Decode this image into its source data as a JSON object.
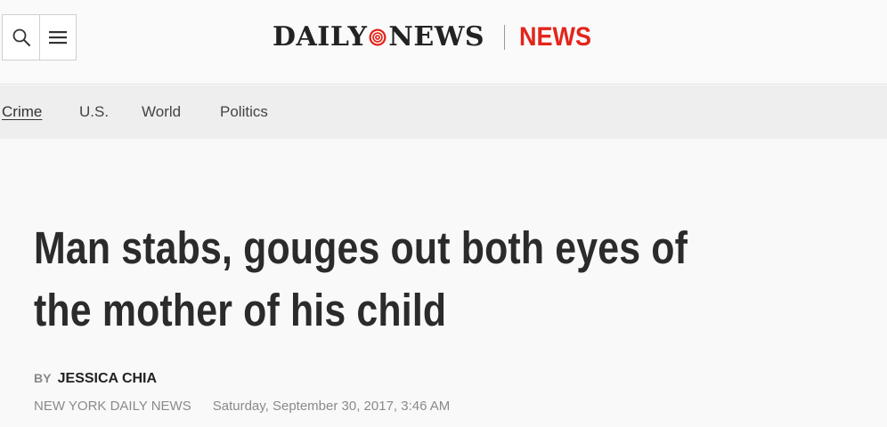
{
  "header": {
    "logo": {
      "word_left": "DAILY",
      "word_right": "NEWS",
      "mark_icon": "daily-news-seal-icon"
    },
    "section": "NEWS",
    "buttons": {
      "search_icon": "search-icon",
      "menu_icon": "hamburger-menu-icon"
    }
  },
  "nav": {
    "items": [
      {
        "label": "Crime",
        "active": true
      },
      {
        "label": "U.S.",
        "active": false
      },
      {
        "label": "World",
        "active": false
      },
      {
        "label": "Politics",
        "active": false
      }
    ]
  },
  "article": {
    "headline": "Man stabs, gouges out both eyes of the mother of his child",
    "byline_prefix": "BY",
    "author": "JESSICA CHIA",
    "source": "NEW YORK DAILY NEWS",
    "date": "Saturday, September 30, 2017, 3:46 AM"
  },
  "colors": {
    "brand_red": "#e3251b",
    "text_dark": "#2b2b2b",
    "meta_gray": "#8a8a8a",
    "nav_bg": "#eeeeee"
  }
}
